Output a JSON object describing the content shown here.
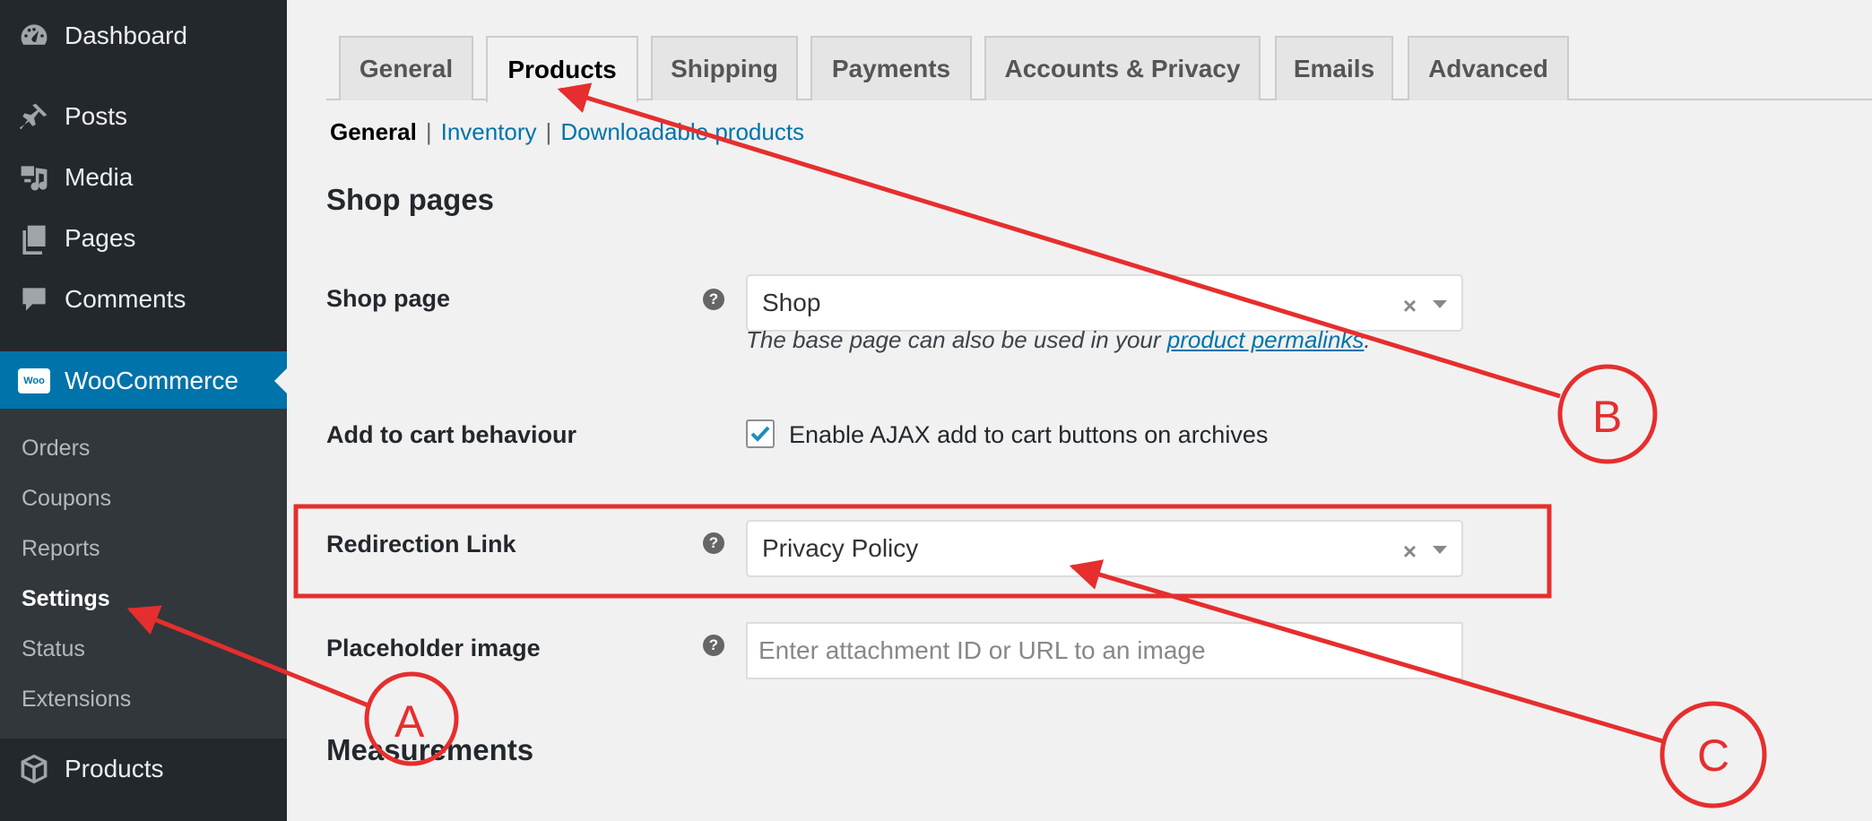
{
  "sidebar": {
    "items": [
      {
        "label": "Dashboard",
        "icon": "dashboard-icon"
      },
      {
        "label": "Posts",
        "icon": "pin-icon"
      },
      {
        "label": "Media",
        "icon": "media-icon"
      },
      {
        "label": "Pages",
        "icon": "pages-icon"
      },
      {
        "label": "Comments",
        "icon": "comment-icon"
      },
      {
        "label": "WooCommerce",
        "icon": "woo-icon"
      },
      {
        "label": "Products",
        "icon": "box-icon"
      }
    ],
    "woo_icon_text": "Woo",
    "submenu": [
      "Orders",
      "Coupons",
      "Reports",
      "Settings",
      "Status",
      "Extensions"
    ],
    "active_color": "#0073aa"
  },
  "tabs": [
    "General",
    "Products",
    "Shipping",
    "Payments",
    "Accounts & Privacy",
    "Emails",
    "Advanced"
  ],
  "subtabs": {
    "current": "General",
    "sep": "|",
    "links": [
      "Inventory",
      "Downloadable products"
    ]
  },
  "shop_pages": {
    "heading": "Shop pages",
    "shop_page": {
      "label": "Shop page",
      "value": "Shop",
      "desc_prefix": "The base page can also be used in your ",
      "desc_link": "product permalinks",
      "desc_suffix": "."
    },
    "add_to_cart": {
      "label": "Add to cart behaviour",
      "checkbox_label": "Enable AJAX add to cart buttons on archives",
      "checked": true
    },
    "redirection": {
      "label": "Redirection Link",
      "value": "Privacy Policy"
    },
    "placeholder_image": {
      "label": "Placeholder image",
      "placeholder": "Enter attachment ID or URL to an image"
    }
  },
  "measurements_heading": "Measurements",
  "help_glyph": "?",
  "clear_glyph": "×",
  "annotations": {
    "labels": [
      "A",
      "B",
      "C"
    ],
    "color": "#e62e2e"
  }
}
